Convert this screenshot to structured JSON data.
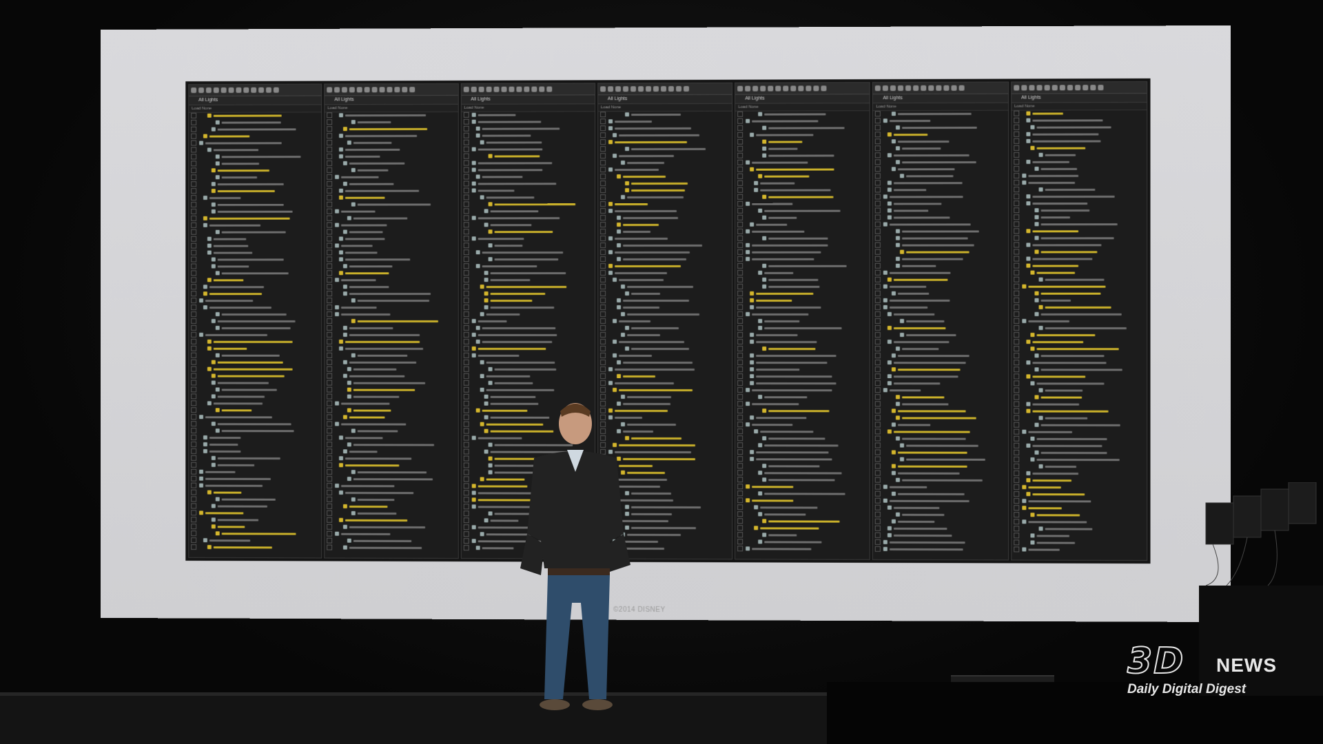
{
  "slide": {
    "copyright": "©2014 DISNEY",
    "panels": [
      {
        "title": "All Lights",
        "sub": "Load  None"
      },
      {
        "title": "All Lights",
        "sub": "Load  None"
      },
      {
        "title": "All Lights",
        "sub": "Load  None"
      },
      {
        "title": "All Lights",
        "sub": "Load  None"
      },
      {
        "title": "All Lights",
        "sub": "Load  None"
      },
      {
        "title": "All Lights",
        "sub": "Load  None"
      },
      {
        "title": "All Lights",
        "sub": "Load  None"
      }
    ]
  },
  "watermark": {
    "brand": "3D",
    "brand_suffix": "NEWS",
    "tagline": "Daily Digital Digest"
  },
  "colors": {
    "screen": "#d4d4d7",
    "slide_bg": "#141414",
    "highlight_text": "#c9b02a"
  }
}
